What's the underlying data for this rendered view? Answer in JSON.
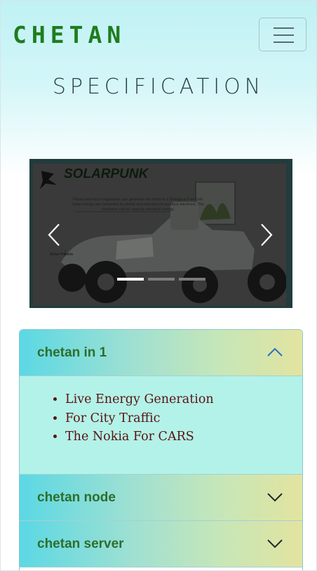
{
  "navbar": {
    "brand": "CHETAN",
    "toggle_icon": "hamburger-menu-icon"
  },
  "page": {
    "title": "SPECIFICATION"
  },
  "carousel": {
    "slide_brand": "SOLARPUNK",
    "slide_caption": "Plants and micro organisms can generate electricity in a Biological Fuel Cell. Solar energy are converted by plants and microbes to produce electrons. The electrons can be used as electrical energy.",
    "slide_note": "Solar Panels",
    "prev_icon": "chevron-left-icon",
    "next_icon": "chevron-right-icon",
    "indicator_count": 3,
    "active_index": 0
  },
  "accordion": {
    "items": [
      {
        "label": "chetan in 1",
        "expanded": true,
        "points": [
          "Live Energy Generation",
          "For City Traffic",
          "The Nokia For CARS"
        ]
      },
      {
        "label": "chetan node",
        "expanded": false
      },
      {
        "label": "chetan server",
        "expanded": false
      }
    ]
  },
  "colors": {
    "brand": "#1e7d1e",
    "accordion_label": "#2e6e2c",
    "list_text": "#5a1212",
    "accordion_body": "#b3f2e8"
  }
}
